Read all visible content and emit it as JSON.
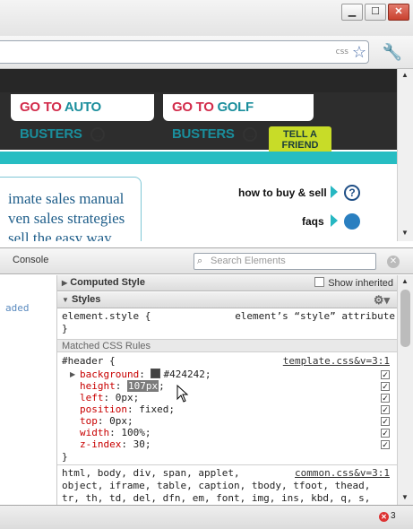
{
  "window": {
    "minimize": "▁",
    "maximize": "☐",
    "close": "✕"
  },
  "browser": {
    "css_label": "css"
  },
  "page": {
    "nav_tabs": [
      {
        "red": "GO TO",
        "teal": "AUTO BUSTERS",
        "arrow": "→"
      },
      {
        "red": "GO TO",
        "teal": "GOLF BUSTERS",
        "arrow": "→"
      }
    ],
    "tell_a_friend": [
      "TELL A",
      "FRIEND"
    ],
    "promo_lines": [
      "imate sales manual",
      "ven sales strategies",
      "sell the easy way"
    ],
    "links": {
      "how_to": "how to buy & sell",
      "faqs": "faqs"
    }
  },
  "devtools": {
    "console_tab": "Console",
    "search_placeholder": "Search Elements",
    "loaded_text": "aded",
    "computed_style": "Computed Style",
    "show_inherited": "Show inherited",
    "styles": "Styles",
    "element_style": {
      "selector": "element.style {",
      "note": "element’s “style” attribute",
      "close": "}"
    },
    "matched_rules_label": "Matched CSS Rules",
    "header_rule": {
      "selector": "#header {",
      "source": "template.css&v=3:1",
      "properties": [
        {
          "name": "background",
          "value": "#424242;",
          "swatch": "#424242",
          "expandable": true
        },
        {
          "name": "height",
          "value": "107px",
          "selected": true
        },
        {
          "name": "left",
          "value": "0px;"
        },
        {
          "name": "position",
          "value": "fixed;"
        },
        {
          "name": "top",
          "value": "0px;"
        },
        {
          "name": "width",
          "value": "100%;"
        },
        {
          "name": "z-index",
          "value": "30;"
        }
      ],
      "close": "}"
    },
    "common_rule": {
      "source": "common.css&v=3:1",
      "lines": [
        "html, body, div, span, applet,",
        "object, iframe, table, caption, tbody, tfoot, thead,",
        "tr, th, td, del, dfn, em, font, img, ins, kbd, q, s,"
      ]
    },
    "error_count": "3"
  },
  "colors": {
    "accent_teal": "#26bdc2",
    "accent_red": "#d22b4a",
    "tell_green": "#c8dc28",
    "header_bg": "#424242"
  }
}
